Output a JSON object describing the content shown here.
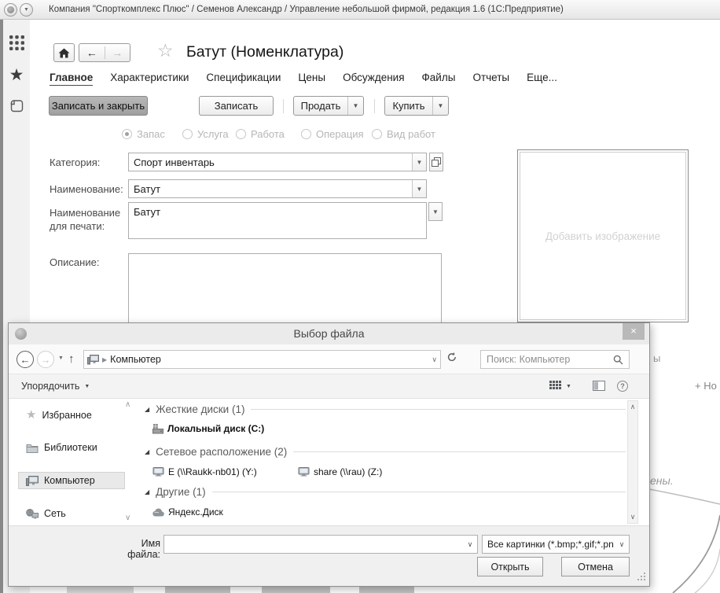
{
  "colors": {
    "primary_button_bg": "#a9a9a9",
    "dialog_close_bg": "#b9b9b9",
    "selected_place_bg": "#e9e9e9",
    "disabled_text": "#b6b6b6"
  },
  "app": {
    "titlebar": {
      "title": "Компания \"Спорткомплекс Плюс\" / Семенов Александр / Управление небольшой фирмой, редакция 1.6  (1С:Предприятие)"
    },
    "form": {
      "title": "Батут (Номенклатура)",
      "tabs": [
        {
          "label": "Главное",
          "active": true
        },
        {
          "label": "Характеристики"
        },
        {
          "label": "Спецификации"
        },
        {
          "label": "Цены"
        },
        {
          "label": "Обсуждения"
        },
        {
          "label": "Файлы"
        },
        {
          "label": "Отчеты"
        },
        {
          "label": "Еще..."
        }
      ],
      "commands": {
        "save_close": "Записать и закрыть",
        "save": "Записать",
        "sell": "Продать",
        "buy": "Купить"
      },
      "type_radios": [
        {
          "label": "Запас",
          "selected": true
        },
        {
          "label": "Услуга",
          "selected": false
        },
        {
          "label": "Работа",
          "selected": false
        },
        {
          "label": "Операция",
          "selected": false
        },
        {
          "label": "Вид работ",
          "selected": false
        }
      ],
      "fields": {
        "category_label": "Категория:",
        "category_value": "Спорт инвентарь",
        "name_label": "Наименование:",
        "name_value": "Батут",
        "print_name_label": "Наименование для печати:",
        "print_name_value": "Батут",
        "description_label": "Описание:",
        "description_value": ""
      },
      "image_placeholder": "Добавить изображение",
      "obscured_fragments": {
        "fragment_top": "ы",
        "fragment_new": "+ Но",
        "fragment_italic": "ены."
      }
    }
  },
  "dialog": {
    "title": "Выбор файла",
    "close_label": "×",
    "nav": {
      "address_root": "Компьютер",
      "search_placeholder": "Поиск: Компьютер"
    },
    "toolbar": {
      "organize_label": "Упорядочить"
    },
    "places": [
      {
        "label": "Избранное"
      },
      {
        "label": "Библиотеки"
      },
      {
        "label": "Компьютер",
        "selected": true
      },
      {
        "label": "Сеть"
      }
    ],
    "groups": [
      {
        "label": "Жесткие диски (1)"
      },
      {
        "label": "Сетевое расположение (2)"
      },
      {
        "label": "Другие (1)"
      }
    ],
    "items": {
      "local_disk": "Локальный диск (C:)",
      "net_drive_y": "E (\\\\Raukk-nb01) (Y:)",
      "net_drive_z": "share (\\\\rau) (Z:)",
      "yandex_disk": "Яндекс.Диск"
    },
    "footer": {
      "filename_label": "Имя файла:",
      "filename_value": "",
      "filter_value": "Все картинки (*.bmp;*.gif;*.pn",
      "open_label": "Открыть",
      "cancel_label": "Отмена"
    }
  }
}
